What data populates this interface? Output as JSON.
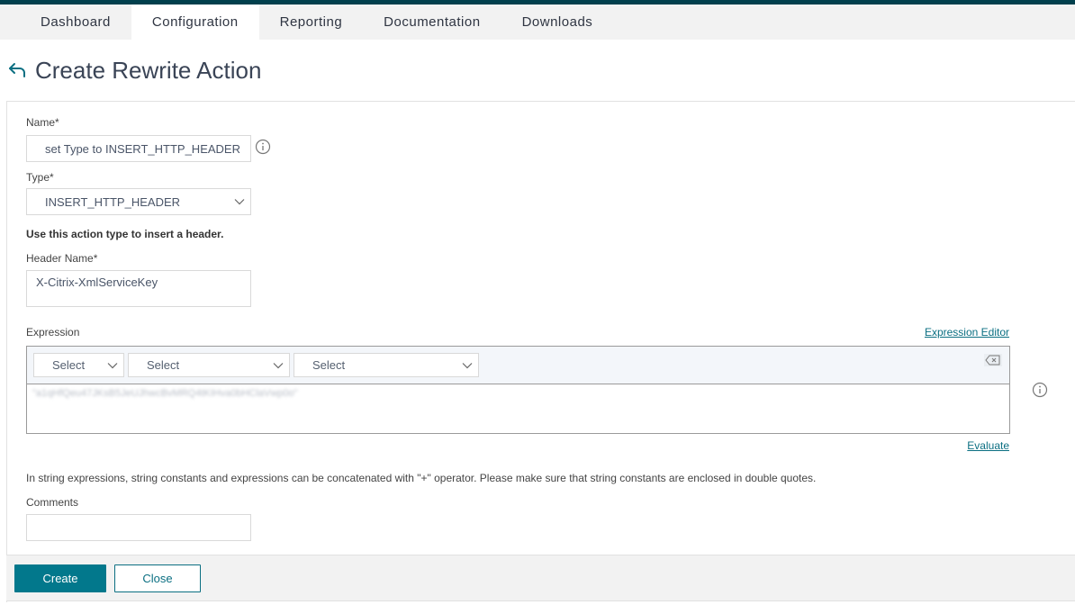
{
  "nav": {
    "tabs": [
      {
        "label": "Dashboard",
        "active": false
      },
      {
        "label": "Configuration",
        "active": true
      },
      {
        "label": "Reporting",
        "active": false
      },
      {
        "label": "Documentation",
        "active": false
      },
      {
        "label": "Downloads",
        "active": false
      }
    ]
  },
  "page": {
    "title": "Create Rewrite Action"
  },
  "form": {
    "name_label": "Name*",
    "name_value": "set Type to INSERT_HTTP_HEADER",
    "type_label": "Type*",
    "type_value": "INSERT_HTTP_HEADER",
    "type_note": "Use this action type to insert a header.",
    "header_name_label": "Header Name*",
    "header_name_value": "X-Citrix-XmlServiceKey",
    "expression_label": "Expression",
    "expression_editor_link": "Expression Editor",
    "expression_selects": [
      "Select",
      "Select",
      "Select"
    ],
    "expression_value_redacted": "\"a1qHfQeu47JKsB5JeUJhwcBvMRQ4tKIHva0bHClaVwp0o\"",
    "evaluate_link": "Evaluate",
    "hint": "In string expressions, string constants and expressions can be concatenated with \"+\" operator. Please make sure that string constants are enclosed in double quotes.",
    "comments_label": "Comments",
    "comments_value": ""
  },
  "footer": {
    "create_label": "Create",
    "close_label": "Close"
  },
  "colors": {
    "accent": "#02788c",
    "topbar": "#01404d",
    "link": "#0b6f82"
  }
}
